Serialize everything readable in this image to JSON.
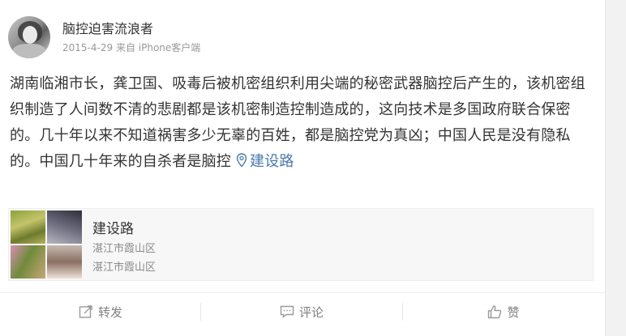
{
  "post": {
    "username": "脑控迫害流浪者",
    "timestamp": "2015-4-29",
    "source_prefix": "来自",
    "source": "iPhone客户端",
    "text": "湖南临湘市长，龚卫国、吸毒后被机密组织利用尖端的秘密武器脑控后产生的，该机密组织制造了人间数不清的悲剧都是该机密制造控制造成的，这向技术是多国政府联合保密的。几十年以来不知道祸害多少无辜的百姓，都是脑控党为真凶；中国人民是没有隐私的。中国几十年来的自杀者是脑控",
    "location_link": "建设路",
    "location_icon": "map-pin-icon"
  },
  "place_card": {
    "name": "建设路",
    "address_line1": "湛江市霞山区",
    "address_line2": "湛江市霞山区"
  },
  "actions": {
    "repost": "转发",
    "comment": "评论",
    "like": "赞"
  },
  "colors": {
    "link": "#4a7aae",
    "text": "#333333",
    "muted": "#999999"
  }
}
